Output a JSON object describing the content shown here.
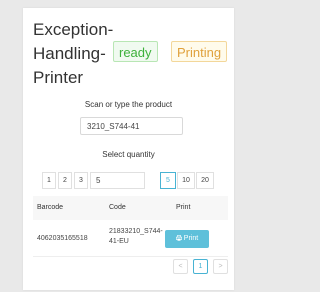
{
  "header": {
    "title": "Exception-Handling-Printer",
    "title_lines": [
      "Exception-",
      "Handling-",
      "Printer"
    ],
    "status_badge": "ready",
    "state_badge": "Printing"
  },
  "scan": {
    "label": "Scan or type the product",
    "value": "3210_S744-41"
  },
  "quantity": {
    "label": "Select quantity",
    "buttons": [
      "1",
      "2",
      "3"
    ],
    "input_value": "5",
    "presets": [
      "5",
      "10",
      "20"
    ],
    "selected": "5"
  },
  "table": {
    "columns": [
      "Barcode",
      "Code",
      "Print"
    ],
    "rows": [
      {
        "barcode": "4062035165518",
        "code_lines": [
          "21833210_S744-",
          "41-EU"
        ],
        "action": "Print"
      }
    ]
  },
  "pagination": {
    "prev": "<",
    "current": "1",
    "next": ">"
  },
  "colors": {
    "ready": "#3db13b",
    "printing": "#e0a13c",
    "accent": "#48b3d3",
    "print_button": "#5ec0da"
  }
}
